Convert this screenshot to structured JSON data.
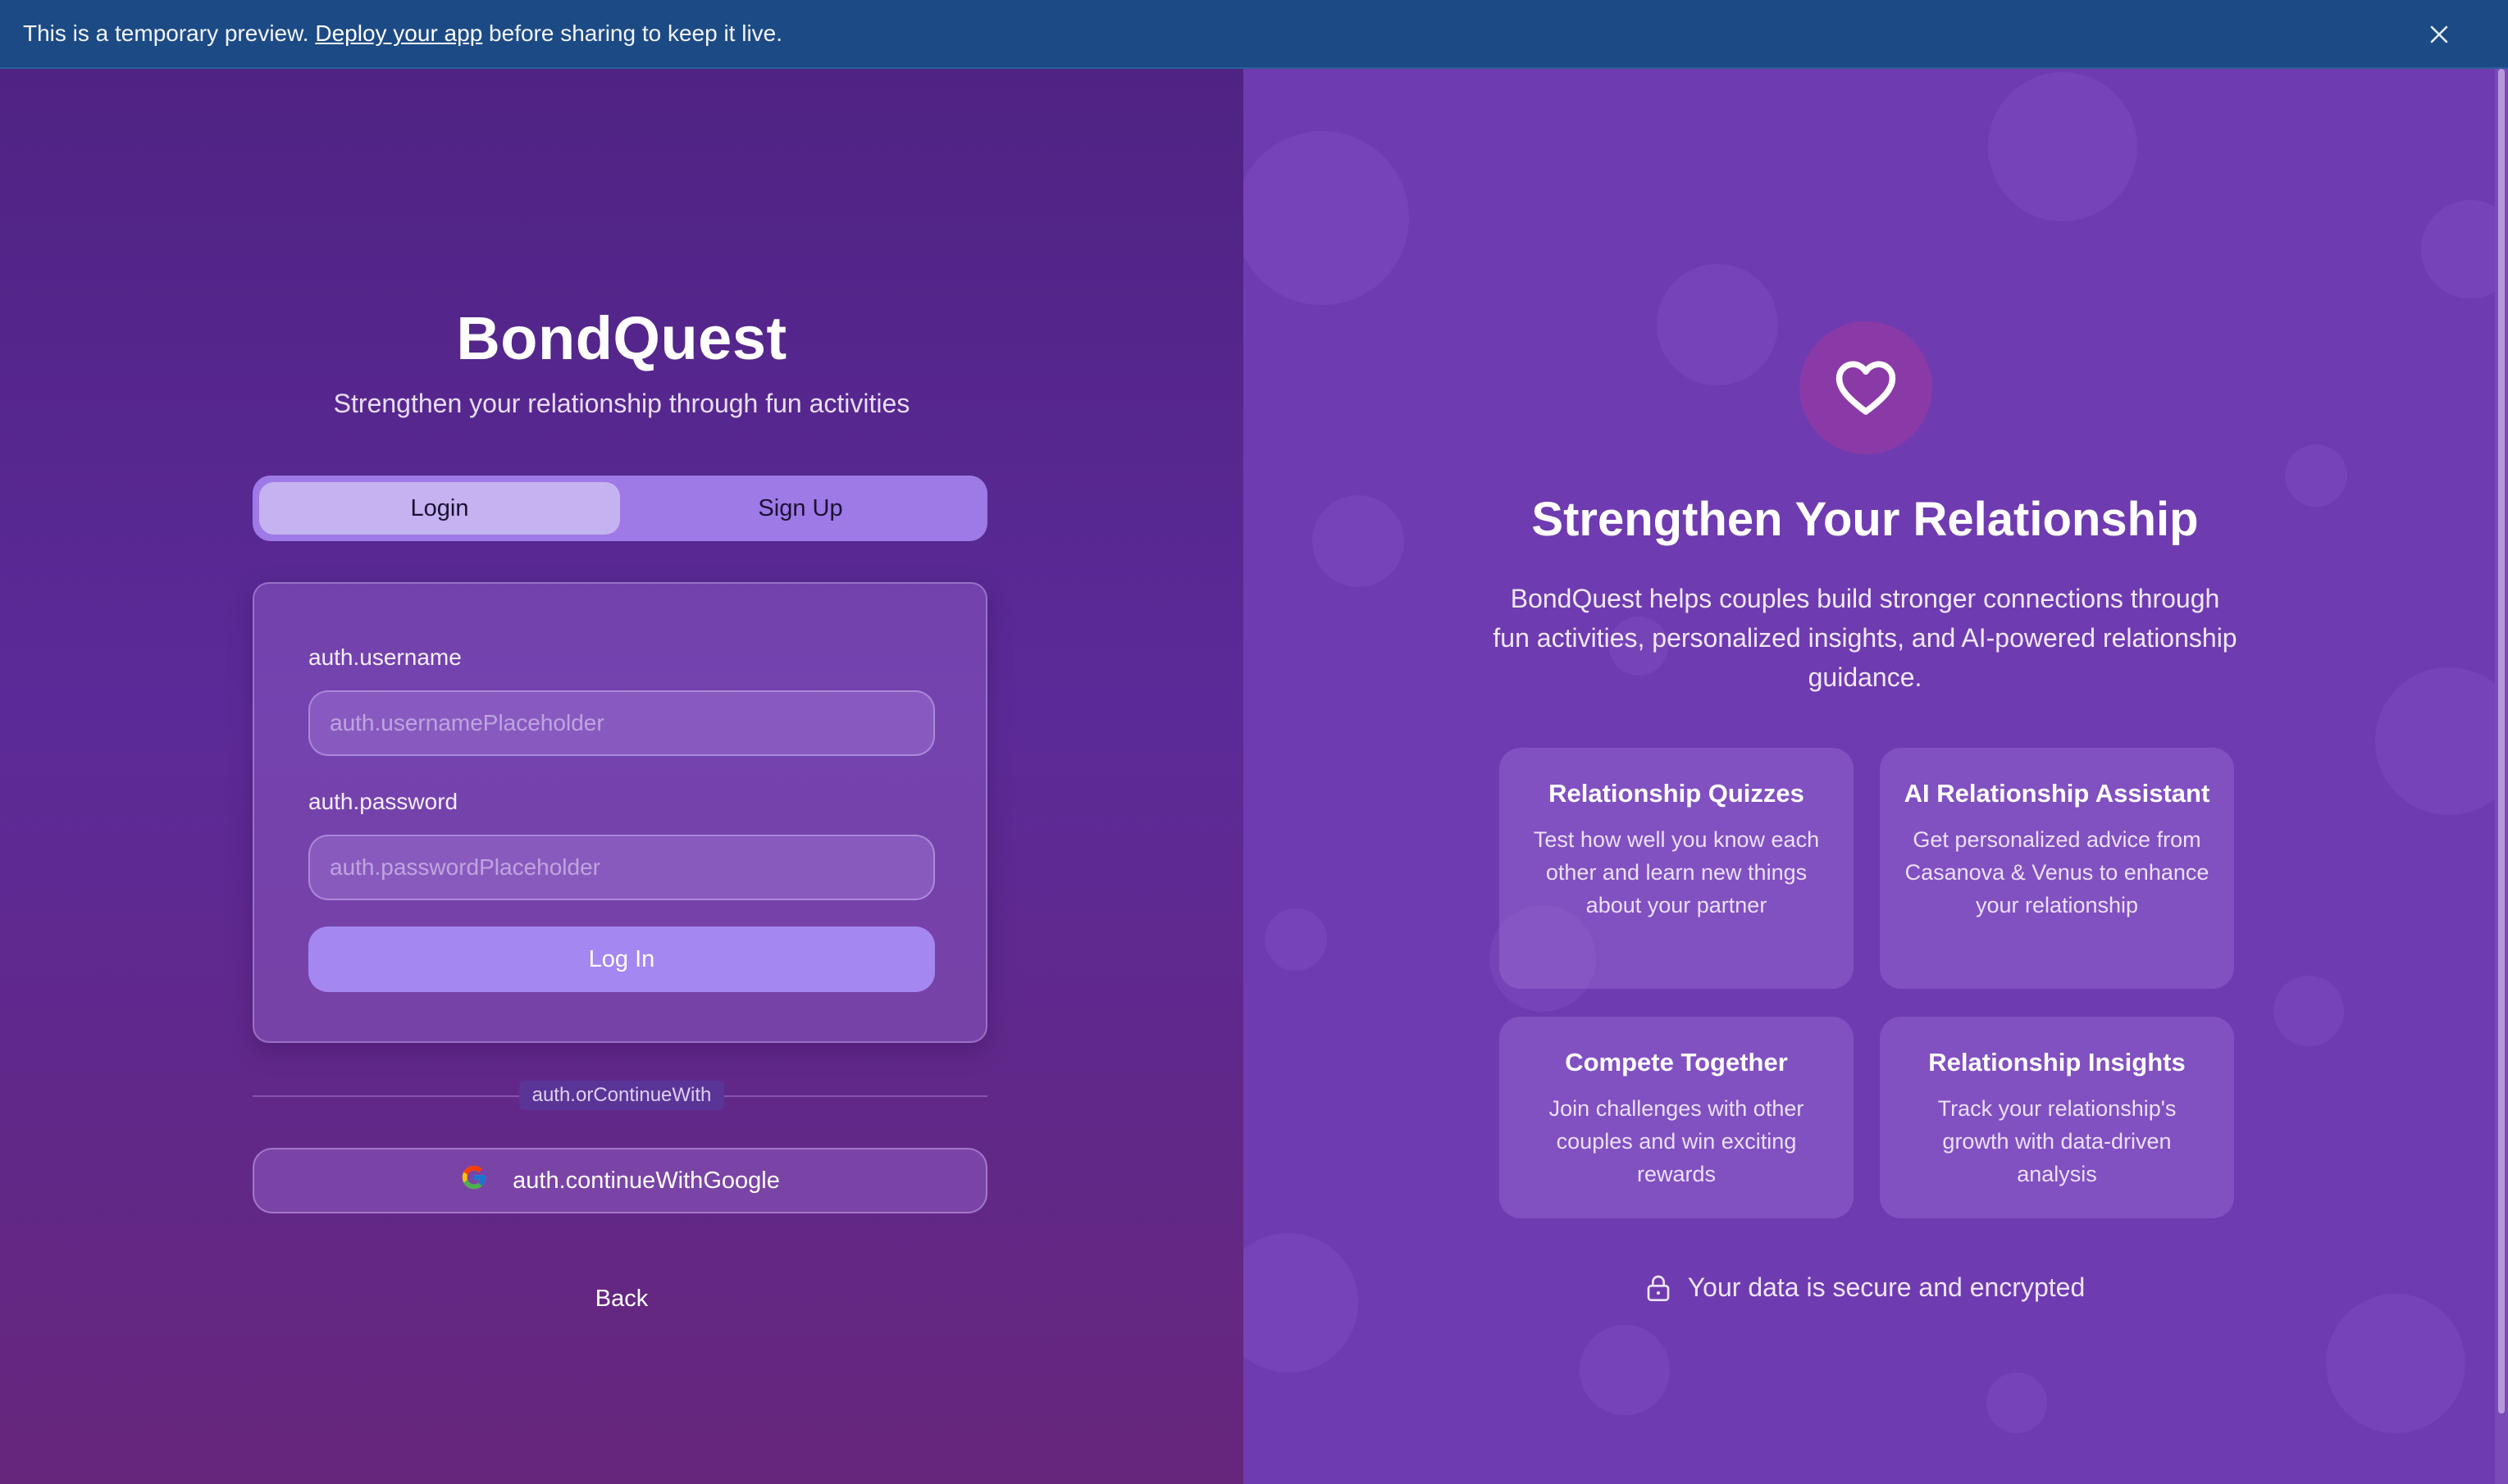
{
  "banner": {
    "text_before": "This is a temporary preview.",
    "link_text": "Deploy your app",
    "text_after": "before sharing to keep it live.",
    "close_icon": "close-icon"
  },
  "auth": {
    "brand": "BondQuest",
    "tagline": "Strengthen your relationship through fun activities",
    "tabs": [
      {
        "label": "Login",
        "active": true
      },
      {
        "label": "Sign Up",
        "active": false
      }
    ],
    "form": {
      "username_label": "auth.username",
      "username_placeholder": "auth.usernamePlaceholder",
      "username_value": "",
      "password_label": "auth.password",
      "password_placeholder": "auth.passwordPlaceholder",
      "password_value": "",
      "submit_label": "Log In"
    },
    "divider_text": "auth.orContinueWith",
    "google_label": "auth.continueWithGoogle",
    "google_icon": "google-icon",
    "back_label": "Back"
  },
  "promo": {
    "heart_icon": "heart-icon",
    "title": "Strengthen Your Relationship",
    "description": "BondQuest helps couples build stronger connections through fun activities, personalized insights, and AI-powered relationship guidance.",
    "features": [
      {
        "title": "Relationship Quizzes",
        "text": "Test how well you know each other and learn new things about your partner"
      },
      {
        "title": "AI Relationship Assistant",
        "text": "Get personalized advice from Casanova & Venus to enhance your relationship"
      },
      {
        "title": "Compete Together",
        "text": "Join challenges with other couples and win exciting rewards"
      },
      {
        "title": "Relationship Insights",
        "text": "Track your relationship's growth with data-driven analysis"
      }
    ],
    "secure_text": "Your data is secure and encrypted",
    "lock_icon": "lock-icon"
  },
  "colors": {
    "banner_bg": "#1c4a85",
    "left_bg_top": "#4f2383",
    "left_bg_bottom": "#66267c",
    "right_bg": "#6f3bb0",
    "accent_button": "#a587f2",
    "heart_circle": "#8a3aa6"
  }
}
